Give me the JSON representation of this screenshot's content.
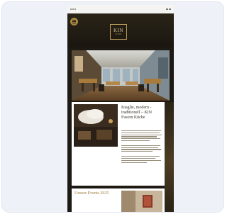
{
  "brand": {
    "logo_main": "KIN",
    "logo_sub": "ISTOR"
  },
  "hero": {
    "label": "KIN FUSION CUISINE"
  },
  "article": {
    "title": "Ktaglie, modern - traditionell – KIN Fusion Küche",
    "body_lines": 12
  },
  "events": {
    "title": "Unsere Events 2025"
  },
  "colors": {
    "gold": "#b89a57",
    "dark": "#1d1a14",
    "card_bg": "#eef2f8"
  }
}
